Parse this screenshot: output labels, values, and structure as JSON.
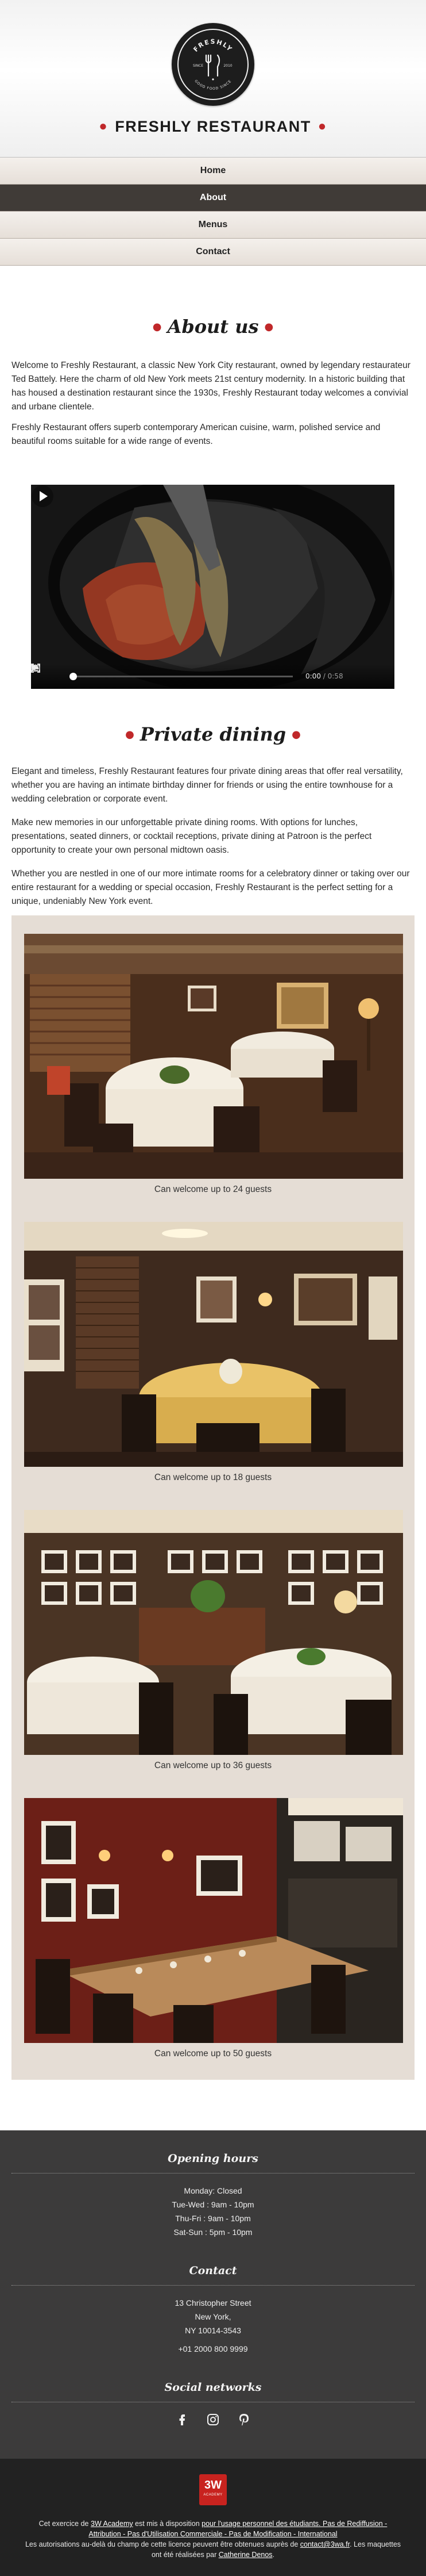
{
  "header": {
    "logo": {
      "top_text": "FRESHLY",
      "left_text": "SINCE",
      "right_text": "2010",
      "bottom_text": "GOOD FOOD SINCE"
    },
    "title": "FRESHLY RESTAURANT",
    "accent_color": "#c0282a"
  },
  "nav": {
    "items": [
      {
        "label": "Home",
        "active": false
      },
      {
        "label": "About",
        "active": true
      },
      {
        "label": "Menus",
        "active": false
      },
      {
        "label": "Contact",
        "active": false
      }
    ]
  },
  "about": {
    "title": "About us",
    "paragraphs": [
      "Welcome to Freshly Restaurant, a classic New York City restaurant, owned by legendary restaurateur Ted Battely. Here the charm of old New York meets 21st century modernity. In a historic building that has housed a destination restaurant since the 1930s, Freshly Restaurant today welcomes a convivial and urbane clientele.",
      "Freshly Restaurant offers superb contemporary American cuisine, warm, polished service and beautiful rooms suitable for a wide range of events."
    ],
    "video": {
      "current_time": "0:00",
      "separator": " / ",
      "duration": "0:58",
      "progress": 0
    }
  },
  "dining": {
    "title": "Private dining",
    "paragraphs": [
      "Elegant and timeless, Freshly Restaurant features four private dining areas that offer real versatility, whether you are having an intimate birthday dinner for friends or using the entire townhouse for a wedding celebration or corporate event.",
      "Make new memories in our unforgettable private dining rooms. With options for lunches, presentations, seated dinners, or cocktail receptions, private dining at Patroon is the perfect opportunity to create your own personal midtown oasis.",
      "Whether you are nestled in one of our more intimate rooms for a celebratory dinner or taking over our entire restaurant for a wedding or special occasion, Freshly Restaurant is the perfect setting for a unique, undeniably New York event."
    ],
    "rooms": [
      {
        "caption": "Can welcome up to 24 guests"
      },
      {
        "caption": "Can welcome up to 18 guests"
      },
      {
        "caption": "Can welcome up to 36 guests"
      },
      {
        "caption": "Can welcome up to 50 guests"
      }
    ]
  },
  "footer": {
    "hours": {
      "title": "Opening hours",
      "lines": [
        "Monday: Closed",
        "Tue-Wed : 9am - 10pm",
        "Thu-Fri : 9am - 10pm",
        "Sat-Sun : 5pm - 10pm"
      ]
    },
    "contact": {
      "title": "Contact",
      "lines": [
        "13 Christopher Street",
        "New York,",
        "NY 10014-3543",
        "+01 2000 800 9999"
      ]
    },
    "social": {
      "title": "Social networks",
      "icons": [
        "facebook-icon",
        "instagram-icon",
        "pinterest-icon"
      ]
    }
  },
  "credits": {
    "badge_main": "3W",
    "badge_sub": "ACADEMY",
    "line1_pre": "Cet exercice de ",
    "line1_link": "3W Academy",
    "line1_mid": " est mis à disposition ",
    "line1_link2": "pour l'usage personnel des étudiants. Pas de Rediffusion - Attribution - Pas d'Utilisation Commerciale - Pas de Modification - International",
    "line2_pre": "Les autorisations au-delà du champ de cette licence peuvent être obtenues auprès de ",
    "line2_link": "contact@3wa.fr",
    "line2_mid": ". Les maquettes ont été réalisées par ",
    "line2_link2": "Catherine Denos",
    "line2_end": "."
  }
}
